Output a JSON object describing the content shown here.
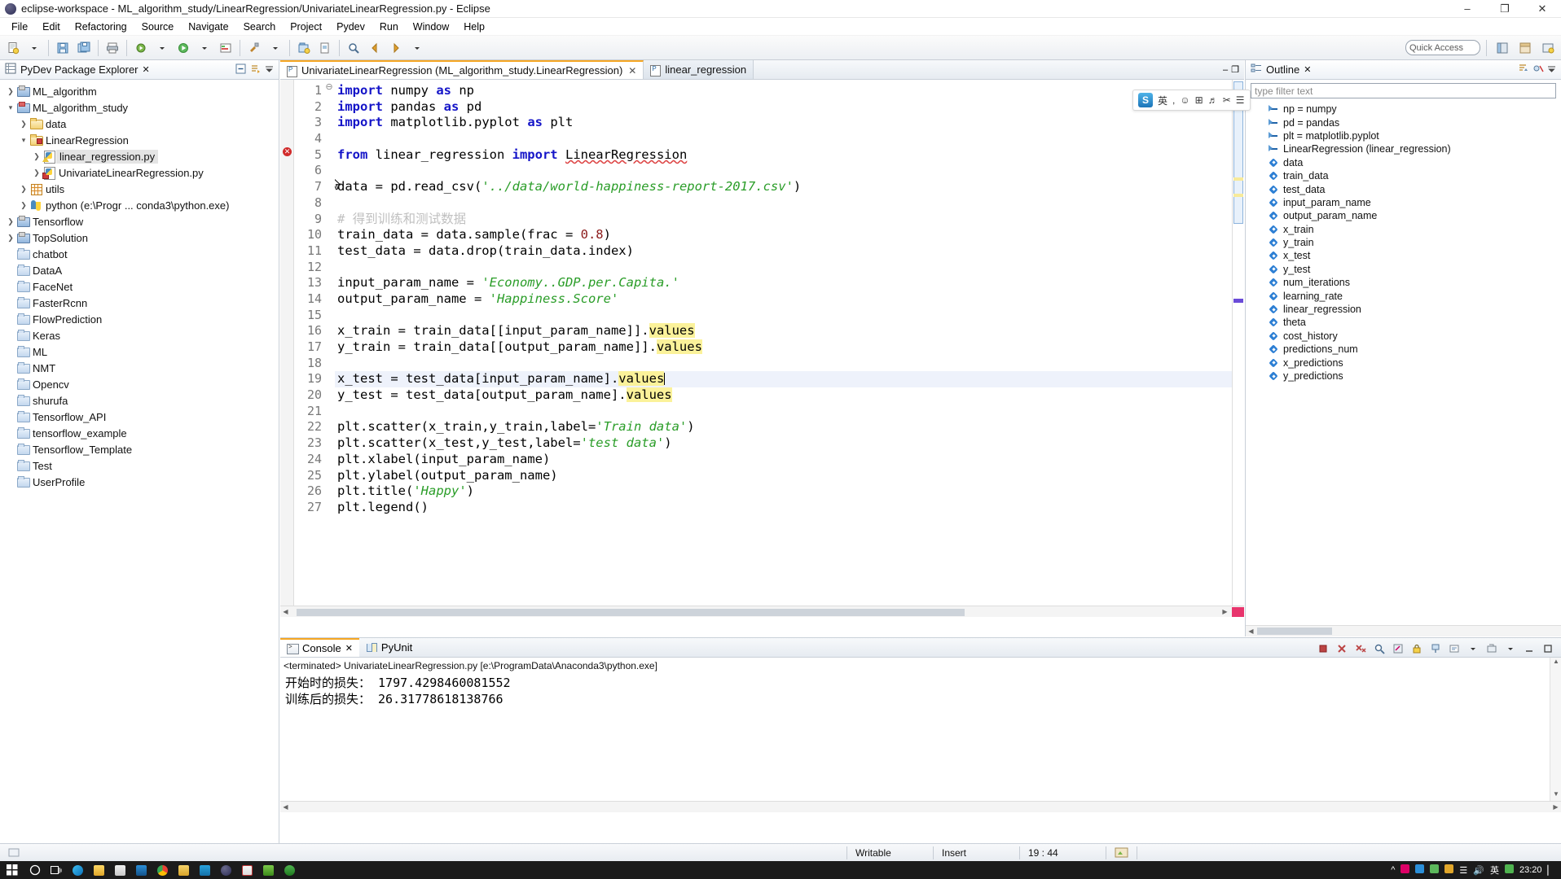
{
  "window": {
    "title": "eclipse-workspace - ML_algorithm_study/LinearRegression/UnivariateLinearRegression.py - Eclipse",
    "minimize": "–",
    "maximize": "❐",
    "close": "✕"
  },
  "menubar": [
    "File",
    "Edit",
    "Refactoring",
    "Source",
    "Navigate",
    "Search",
    "Project",
    "Pydev",
    "Run",
    "Window",
    "Help"
  ],
  "toolbar": {
    "quick_access_placeholder": "Quick Access"
  },
  "explorer": {
    "title": "PyDev Package Explorer",
    "close_label": "✕",
    "items": [
      {
        "label": "ML_algorithm",
        "icon": "project-icon",
        "indent": 0,
        "arrow": "collapsed",
        "kind": "proj",
        "error": false
      },
      {
        "label": "ML_algorithm_study",
        "icon": "project-icon",
        "indent": 0,
        "arrow": "expanded",
        "kind": "proj",
        "error": true
      },
      {
        "label": "data",
        "icon": "folder-icon",
        "indent": 1,
        "arrow": "collapsed",
        "kind": "folder",
        "error": false
      },
      {
        "label": "LinearRegression",
        "icon": "folder-icon",
        "indent": 1,
        "arrow": "expanded",
        "kind": "folder",
        "error": true
      },
      {
        "label": "linear_regression.py",
        "icon": "python-file-icon",
        "indent": 2,
        "arrow": "collapsed",
        "kind": "py-warn",
        "error": false,
        "selected": true
      },
      {
        "label": "UnivariateLinearRegression.py",
        "icon": "python-file-icon",
        "indent": 2,
        "arrow": "collapsed",
        "kind": "py-err",
        "error": true
      },
      {
        "label": "utils",
        "icon": "grid-icon",
        "indent": 1,
        "arrow": "collapsed",
        "kind": "grid",
        "error": false
      },
      {
        "label": "python  (e:\\Progr ... conda3\\python.exe)",
        "icon": "python-interpreter-icon",
        "indent": 1,
        "arrow": "collapsed",
        "kind": "pyint",
        "error": false
      },
      {
        "label": "Tensorflow",
        "icon": "project-icon",
        "indent": 0,
        "arrow": "collapsed",
        "kind": "proj",
        "error": false
      },
      {
        "label": "TopSolution",
        "icon": "project-icon",
        "indent": 0,
        "arrow": "collapsed",
        "kind": "proj",
        "error": false
      },
      {
        "label": "chatbot",
        "icon": "folder-icon",
        "indent": 0,
        "arrow": "none",
        "kind": "bfolder",
        "error": false
      },
      {
        "label": "DataA",
        "icon": "folder-icon",
        "indent": 0,
        "arrow": "none",
        "kind": "bfolder",
        "error": false
      },
      {
        "label": "FaceNet",
        "icon": "folder-icon",
        "indent": 0,
        "arrow": "none",
        "kind": "bfolder",
        "error": false
      },
      {
        "label": "FasterRcnn",
        "icon": "folder-icon",
        "indent": 0,
        "arrow": "none",
        "kind": "bfolder",
        "error": false
      },
      {
        "label": "FlowPrediction",
        "icon": "folder-icon",
        "indent": 0,
        "arrow": "none",
        "kind": "bfolder",
        "error": false
      },
      {
        "label": "Keras",
        "icon": "folder-icon",
        "indent": 0,
        "arrow": "none",
        "kind": "bfolder",
        "error": false
      },
      {
        "label": "ML",
        "icon": "folder-icon",
        "indent": 0,
        "arrow": "none",
        "kind": "bfolder",
        "error": false
      },
      {
        "label": "NMT",
        "icon": "folder-icon",
        "indent": 0,
        "arrow": "none",
        "kind": "bfolder",
        "error": false
      },
      {
        "label": "Opencv",
        "icon": "folder-icon",
        "indent": 0,
        "arrow": "none",
        "kind": "bfolder",
        "error": false
      },
      {
        "label": "shurufa",
        "icon": "folder-icon",
        "indent": 0,
        "arrow": "none",
        "kind": "bfolder",
        "error": false
      },
      {
        "label": "Tensorflow_API",
        "icon": "folder-icon",
        "indent": 0,
        "arrow": "none",
        "kind": "bfolder",
        "error": false
      },
      {
        "label": "tensorflow_example",
        "icon": "folder-icon",
        "indent": 0,
        "arrow": "none",
        "kind": "bfolder",
        "error": false
      },
      {
        "label": "Tensorflow_Template",
        "icon": "folder-icon",
        "indent": 0,
        "arrow": "none",
        "kind": "bfolder",
        "error": false
      },
      {
        "label": "Test",
        "icon": "folder-icon",
        "indent": 0,
        "arrow": "none",
        "kind": "bfolder",
        "error": false
      },
      {
        "label": "UserProfile",
        "icon": "folder-icon",
        "indent": 0,
        "arrow": "none",
        "kind": "bfolder",
        "error": false
      }
    ]
  },
  "editor": {
    "tabs": [
      {
        "label": "UnivariateLinearRegression (ML_algorithm_study.LinearRegression)",
        "active": true,
        "close": "✕"
      },
      {
        "label": "linear_regression",
        "active": false,
        "close": ""
      }
    ],
    "minimize": "–",
    "maximize": "❐",
    "lines": [
      {
        "n": 1,
        "fold": true,
        "tokens": [
          {
            "t": "import",
            "c": "kw"
          },
          {
            "t": " numpy ",
            "c": ""
          },
          {
            "t": "as",
            "c": "kw"
          },
          {
            "t": " np",
            "c": ""
          }
        ]
      },
      {
        "n": 2,
        "tokens": [
          {
            "t": "import",
            "c": "kw"
          },
          {
            "t": " pandas ",
            "c": ""
          },
          {
            "t": "as",
            "c": "kw"
          },
          {
            "t": " pd",
            "c": ""
          }
        ]
      },
      {
        "n": 3,
        "tokens": [
          {
            "t": "import",
            "c": "kw"
          },
          {
            "t": " matplotlib.pyplot ",
            "c": ""
          },
          {
            "t": "as",
            "c": "kw"
          },
          {
            "t": " plt",
            "c": ""
          }
        ]
      },
      {
        "n": 4,
        "tokens": []
      },
      {
        "n": 5,
        "error": true,
        "tokens": [
          {
            "t": "from",
            "c": "kw"
          },
          {
            "t": " linear_regression ",
            "c": ""
          },
          {
            "t": "import",
            "c": "kw"
          },
          {
            "t": " ",
            "c": ""
          },
          {
            "t": "LinearRegression",
            "c": "err-underline"
          }
        ]
      },
      {
        "n": 6,
        "tokens": []
      },
      {
        "n": 7,
        "tokens": [
          {
            "t": "data = pd.read_csv(",
            "c": ""
          },
          {
            "t": "'../data/world-happiness-report-2017.csv'",
            "c": "str"
          },
          {
            "t": ")",
            "c": ""
          }
        ]
      },
      {
        "n": 8,
        "tokens": []
      },
      {
        "n": 9,
        "tokens": [
          {
            "t": "# 得到训练和测试数据",
            "c": "cmt"
          }
        ]
      },
      {
        "n": 10,
        "tokens": [
          {
            "t": "train_data = data.sample(frac = ",
            "c": ""
          },
          {
            "t": "0.8",
            "c": "num"
          },
          {
            "t": ")",
            "c": ""
          }
        ]
      },
      {
        "n": 11,
        "tokens": [
          {
            "t": "test_data = data.drop(train_data.index)",
            "c": ""
          }
        ]
      },
      {
        "n": 12,
        "tokens": []
      },
      {
        "n": 13,
        "tokens": [
          {
            "t": "input_param_name = ",
            "c": ""
          },
          {
            "t": "'Economy..GDP.per.Capita.'",
            "c": "str"
          }
        ]
      },
      {
        "n": 14,
        "tokens": [
          {
            "t": "output_param_name = ",
            "c": ""
          },
          {
            "t": "'Happiness.Score'",
            "c": "str"
          }
        ]
      },
      {
        "n": 15,
        "tokens": []
      },
      {
        "n": 16,
        "tokens": [
          {
            "t": "x_train = train_data[[input_param_name]].",
            "c": ""
          },
          {
            "t": "values",
            "c": "hl"
          }
        ]
      },
      {
        "n": 17,
        "tokens": [
          {
            "t": "y_train = train_data[[output_param_name]].",
            "c": ""
          },
          {
            "t": "values",
            "c": "hl"
          }
        ]
      },
      {
        "n": 18,
        "tokens": []
      },
      {
        "n": 19,
        "current": true,
        "caret": true,
        "tokens": [
          {
            "t": "x_test = test_data[input_param_name].",
            "c": ""
          },
          {
            "t": "values",
            "c": "hl"
          }
        ]
      },
      {
        "n": 20,
        "tokens": [
          {
            "t": "y_test = test_data[output_param_name].",
            "c": ""
          },
          {
            "t": "values",
            "c": "hl"
          }
        ]
      },
      {
        "n": 21,
        "tokens": []
      },
      {
        "n": 22,
        "tokens": [
          {
            "t": "plt.scatter(x_train,y_train,label=",
            "c": ""
          },
          {
            "t": "'Train data'",
            "c": "str"
          },
          {
            "t": ")",
            "c": ""
          }
        ]
      },
      {
        "n": 23,
        "tokens": [
          {
            "t": "plt.scatter(x_test,y_test,label=",
            "c": ""
          },
          {
            "t": "'test data'",
            "c": "str"
          },
          {
            "t": ")",
            "c": ""
          }
        ]
      },
      {
        "n": 24,
        "tokens": [
          {
            "t": "plt.xlabel(input_param_name)",
            "c": ""
          }
        ]
      },
      {
        "n": 25,
        "tokens": [
          {
            "t": "plt.ylabel(output_param_name)",
            "c": ""
          }
        ]
      },
      {
        "n": 26,
        "tokens": [
          {
            "t": "plt.title(",
            "c": ""
          },
          {
            "t": "'Happy'",
            "c": "str"
          },
          {
            "t": ")",
            "c": ""
          }
        ]
      },
      {
        "n": 27,
        "tokens": [
          {
            "t": "plt.legend()",
            "c": ""
          }
        ]
      }
    ]
  },
  "outline": {
    "title": "Outline",
    "close_label": "✕",
    "filter_placeholder": "type filter text",
    "items": [
      {
        "label": "np = numpy",
        "kind": "import"
      },
      {
        "label": "pd = pandas",
        "kind": "import"
      },
      {
        "label": "plt = matplotlib.pyplot",
        "kind": "import"
      },
      {
        "label": "LinearRegression (linear_regression)",
        "kind": "import"
      },
      {
        "label": "data",
        "kind": "var"
      },
      {
        "label": "train_data",
        "kind": "var"
      },
      {
        "label": "test_data",
        "kind": "var"
      },
      {
        "label": "input_param_name",
        "kind": "var"
      },
      {
        "label": "output_param_name",
        "kind": "var"
      },
      {
        "label": "x_train",
        "kind": "var"
      },
      {
        "label": "y_train",
        "kind": "var"
      },
      {
        "label": "x_test",
        "kind": "var"
      },
      {
        "label": "y_test",
        "kind": "var"
      },
      {
        "label": "num_iterations",
        "kind": "var"
      },
      {
        "label": "learning_rate",
        "kind": "var"
      },
      {
        "label": "linear_regression",
        "kind": "var"
      },
      {
        "label": "theta",
        "kind": "var"
      },
      {
        "label": "cost_history",
        "kind": "var"
      },
      {
        "label": "predictions_num",
        "kind": "var"
      },
      {
        "label": "x_predictions",
        "kind": "var"
      },
      {
        "label": "y_predictions",
        "kind": "var"
      }
    ]
  },
  "ime": {
    "logo": "S",
    "mode": "英",
    "items": [
      "☺",
      "⌨",
      "🎤",
      "✂",
      "⚡"
    ]
  },
  "console": {
    "tabs": [
      {
        "label": "Console",
        "active": true,
        "close": "✕"
      },
      {
        "label": "PyUnit",
        "active": false,
        "close": ""
      }
    ],
    "header": "<terminated> UnivariateLinearRegression.py [e:\\ProgramData\\Anaconda3\\python.exe]",
    "output": [
      "开始时的损失： 1797.4298460081552",
      "训练后的损失： 26.31778618138766"
    ]
  },
  "statusbar": {
    "writable": "Writable",
    "insert": "Insert",
    "position": "19 : 44"
  },
  "taskbar": {
    "time": "23:20",
    "date": "",
    "lang": "英"
  },
  "colors": {
    "accent": "#f5a623",
    "string": "#2a9d28",
    "keyword": "#1414c8",
    "highlight": "#fbf29a",
    "error": "#d12b2b"
  }
}
